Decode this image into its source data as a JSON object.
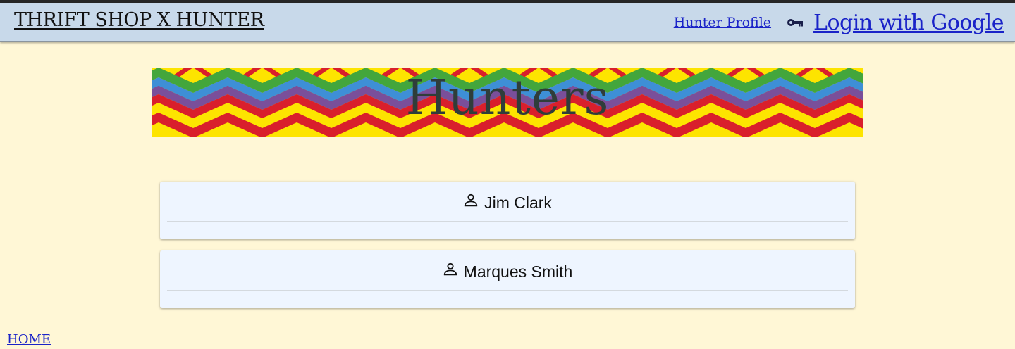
{
  "nav": {
    "brand": "THRIFT SHOP X HUNTER",
    "profile_link": "Hunter Profile",
    "login_link": "Login with Google",
    "login_icon": "key-icon"
  },
  "banner": {
    "title": "Hunters",
    "pattern_colors": [
      "#fde400",
      "#d91f2c",
      "#7a4f9a",
      "#3e8fd6",
      "#43a63c"
    ]
  },
  "hunters": [
    {
      "name": "Jim Clark",
      "icon": "person-icon"
    },
    {
      "name": "Marques Smith",
      "icon": "person-icon"
    }
  ],
  "footer": {
    "home_link": "HOME"
  },
  "colors": {
    "page_background": "#fff7d6",
    "navbar_background": "#c8d9ea",
    "link": "#1a23c8",
    "card_background": "#eef5ff"
  }
}
